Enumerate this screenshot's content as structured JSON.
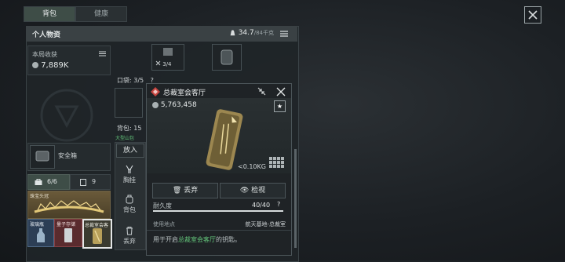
{
  "tabs": [
    {
      "label": "背包",
      "active": true
    },
    {
      "label": "健康",
      "active": false
    }
  ],
  "header": {
    "title": "个人物资",
    "weight_value": "34.7",
    "weight_max": "/84千克"
  },
  "income": {
    "label": "本局收获",
    "value": "7,889K"
  },
  "top_slot": {
    "count": "3/4"
  },
  "safebox": {
    "label": "安全箱"
  },
  "pocket": {
    "label": "口袋:",
    "value": "3/5",
    "extra": "?"
  },
  "backpack": {
    "label": "背包:",
    "value": "15"
  },
  "left_tabs": [
    {
      "label": "6/6"
    },
    {
      "label": "9"
    }
  ],
  "item_cards": [
    {
      "label": "珠宝头冠"
    },
    {
      "label": "玻璃瓶"
    },
    {
      "label": "量子存储"
    },
    {
      "label": "总裁室会客"
    }
  ],
  "side_actions": {
    "place": "放入",
    "chest": "胸挂",
    "bag": "背包",
    "discard": "丢弃"
  },
  "hint_small": "大型山包",
  "popup": {
    "title": "总裁室会客厅",
    "price": "5,763,458",
    "weight": "<0.10KG",
    "discard_label": "丢弃",
    "inspect_label": "检视",
    "durability_label": "耐久度",
    "durability_value": "40/40",
    "durability_q": "?",
    "durability_fraction": 1.0,
    "location_label": "使用地点",
    "location_value": "航天基地-总裁室",
    "desc_prefix": "用于开启",
    "desc_highlight": "总裁室会客厅",
    "desc_suffix": "的钥匙。"
  }
}
